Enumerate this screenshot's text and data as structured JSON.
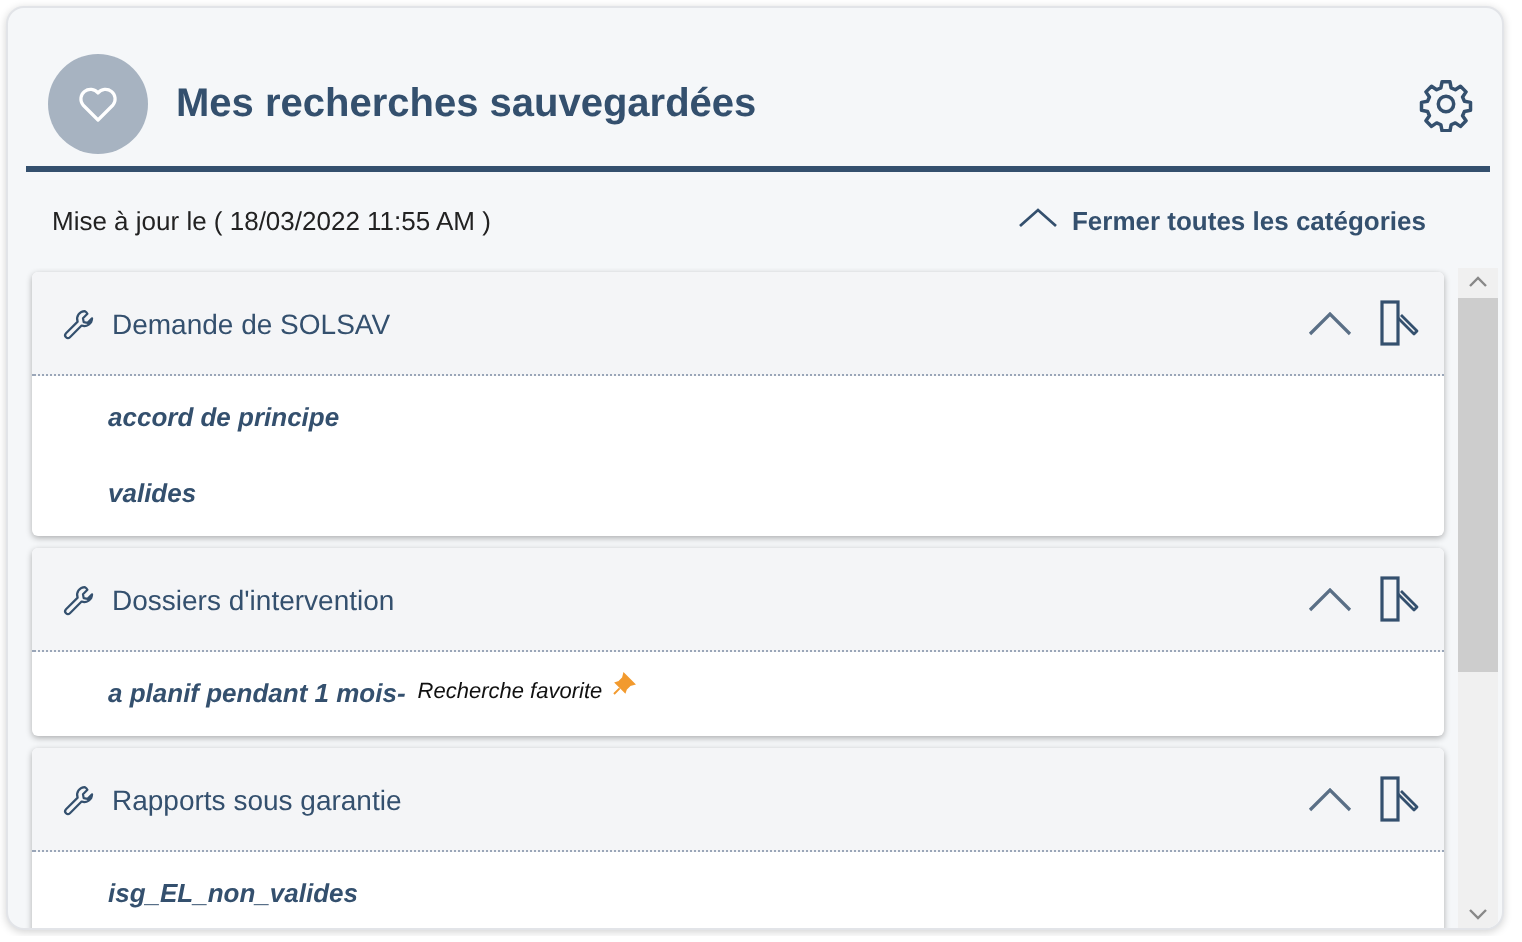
{
  "header": {
    "title": "Mes recherches sauvegardées"
  },
  "update_text": "Mise à jour le ( 18/03/2022 11:55 AM )",
  "collapse_all": "Fermer toutes les catégories",
  "categories": [
    {
      "name": "Demande de SOLSAV",
      "expanded": true,
      "items": [
        {
          "label": "accord de principe"
        },
        {
          "label": "valides"
        }
      ]
    },
    {
      "name": "Dossiers d'intervention",
      "expanded": true,
      "items": [
        {
          "label": "a planif pendant 1 mois-",
          "note": "Recherche favorite",
          "favorite": true
        }
      ]
    },
    {
      "name": "Rapports sous garantie",
      "expanded": true,
      "items": [
        {
          "label": "isg_EL_non_valides"
        }
      ]
    }
  ]
}
